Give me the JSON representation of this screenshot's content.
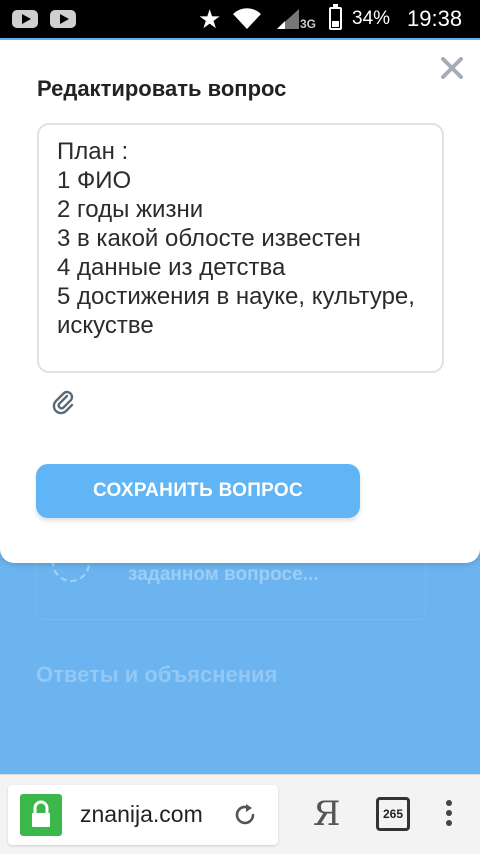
{
  "status_bar": {
    "battery": "34%",
    "network": "3G",
    "time": "19:38",
    "icons": [
      "youtube-icon",
      "youtube-icon",
      "star-icon",
      "wifi-icon",
      "signal-icon",
      "battery-icon"
    ]
  },
  "background": {
    "ask_text": "Спросите Lerapens о заданном вопросе...",
    "answers_heading": "Ответы и объяснения"
  },
  "modal": {
    "title": "Редактировать вопрос",
    "question_text": "План :\n1 ФИО\n2 годы жизни\n3 в какой облосте известен\n4 данные из детства\n5 достижения в науке, культуре, искустве",
    "save_label": "СОХРАНИТЬ ВОПРОС"
  },
  "browser": {
    "url": "znanija.com",
    "yandex_label": "Я",
    "tabs_count": "265"
  },
  "colors": {
    "accent": "#5fb5f5",
    "page_background": "#6cb4f0",
    "lock": "#3cb84a"
  }
}
